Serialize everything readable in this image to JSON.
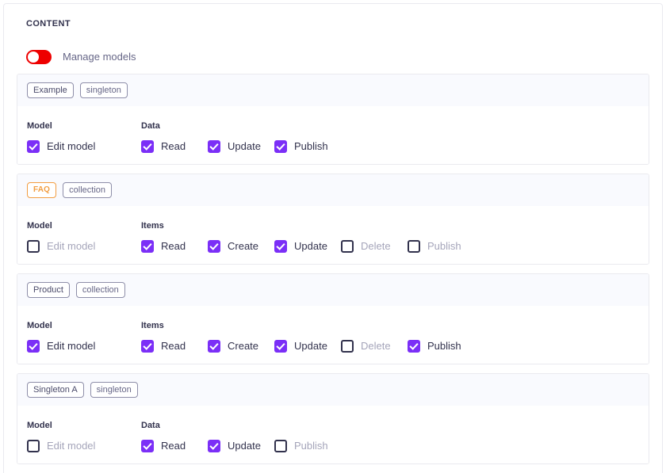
{
  "section": {
    "title": "CONTENT"
  },
  "manage_toggle": {
    "label": "Manage models",
    "state": "off",
    "color": "#ee0000"
  },
  "colors": {
    "checked": "#7b2ff7",
    "accent_badge": "#f29d41",
    "toggle_on": "#ee0000",
    "header_band": "#f9fafe",
    "border": "#eaeaef"
  },
  "cards": [
    {
      "name": "Example",
      "kind": "singleton",
      "accent": false,
      "model_group_title": "Model",
      "model_permission": {
        "label": "Edit model",
        "checked": true
      },
      "actions_group_title": "Data",
      "actions": [
        {
          "label": "Read",
          "checked": true
        },
        {
          "label": "Update",
          "checked": true
        },
        {
          "label": "Publish",
          "checked": true
        }
      ]
    },
    {
      "name": "FAQ",
      "kind": "collection",
      "accent": true,
      "model_group_title": "Model",
      "model_permission": {
        "label": "Edit model",
        "checked": false
      },
      "actions_group_title": "Items",
      "actions": [
        {
          "label": "Read",
          "checked": true
        },
        {
          "label": "Create",
          "checked": true
        },
        {
          "label": "Update",
          "checked": true
        },
        {
          "label": "Delete",
          "checked": false
        },
        {
          "label": "Publish",
          "checked": false
        }
      ]
    },
    {
      "name": "Product",
      "kind": "collection",
      "accent": false,
      "model_group_title": "Model",
      "model_permission": {
        "label": "Edit model",
        "checked": true
      },
      "actions_group_title": "Items",
      "actions": [
        {
          "label": "Read",
          "checked": true
        },
        {
          "label": "Create",
          "checked": true
        },
        {
          "label": "Update",
          "checked": true
        },
        {
          "label": "Delete",
          "checked": false
        },
        {
          "label": "Publish",
          "checked": true
        }
      ]
    },
    {
      "name": "Singleton A",
      "kind": "singleton",
      "accent": false,
      "model_group_title": "Model",
      "model_permission": {
        "label": "Edit model",
        "checked": false
      },
      "actions_group_title": "Data",
      "actions": [
        {
          "label": "Read",
          "checked": true
        },
        {
          "label": "Update",
          "checked": true
        },
        {
          "label": "Publish",
          "checked": false
        }
      ]
    }
  ]
}
